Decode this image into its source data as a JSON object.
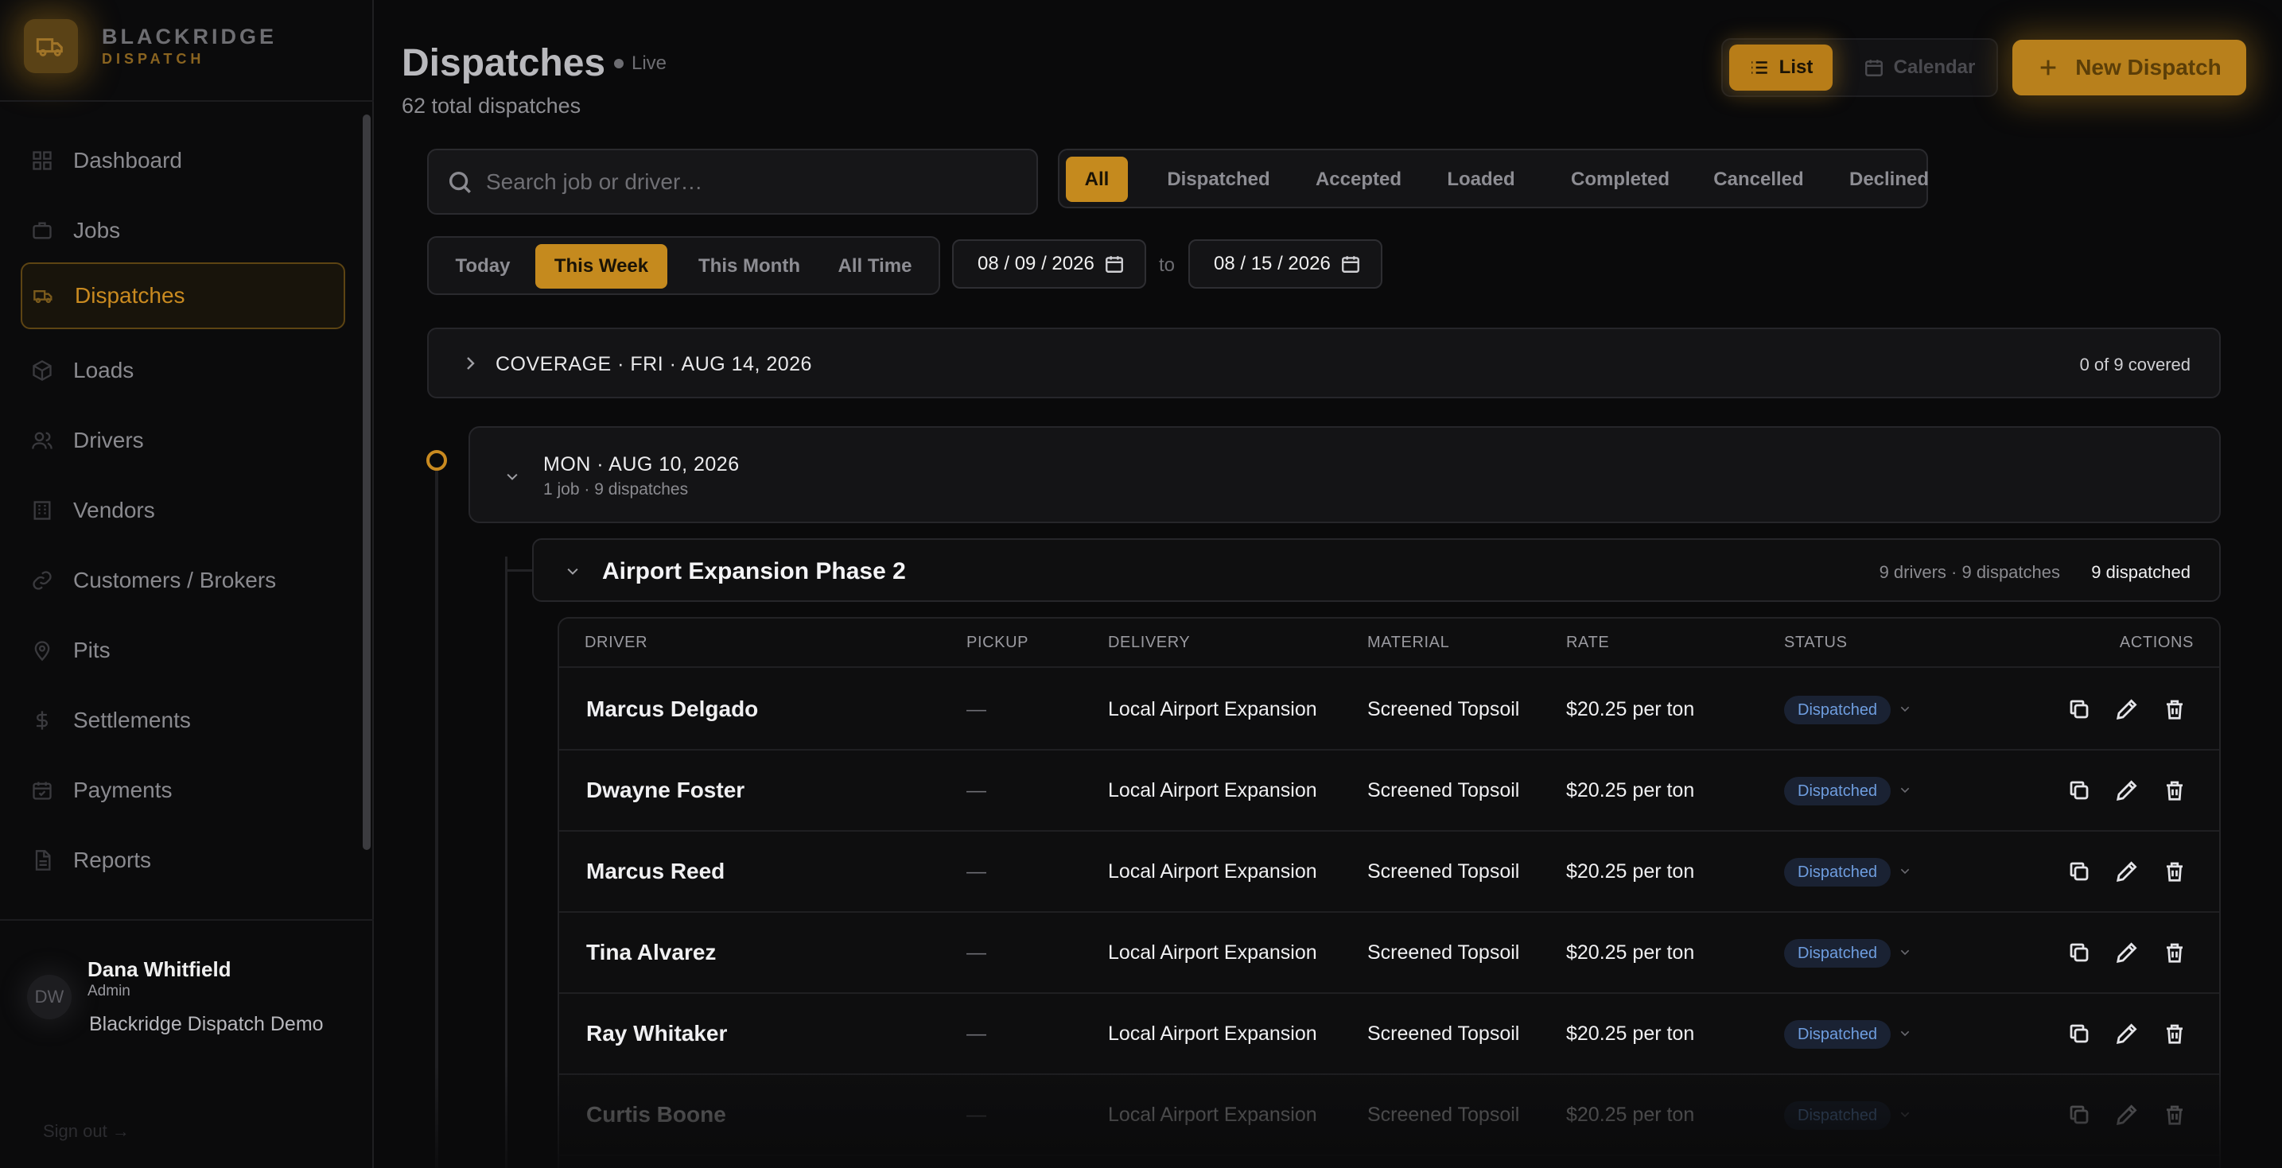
{
  "brand": {
    "name": "BLACKRIDGE",
    "sub": "DISPATCH",
    "logo_icon": "truck-icon"
  },
  "sidebar": {
    "items": [
      {
        "label": "Dashboard",
        "icon": "grid-icon"
      },
      {
        "label": "Jobs",
        "icon": "briefcase-icon"
      },
      {
        "label": "Dispatches",
        "icon": "truck-icon",
        "active": true
      },
      {
        "label": "Loads",
        "icon": "box-icon"
      },
      {
        "label": "Drivers",
        "icon": "users-icon"
      },
      {
        "label": "Vendors",
        "icon": "building-icon"
      },
      {
        "label": "Customers / Brokers",
        "icon": "link-icon"
      },
      {
        "label": "Pits",
        "icon": "map-pin-icon"
      },
      {
        "label": "Settlements",
        "icon": "dollar-icon"
      },
      {
        "label": "Payments",
        "icon": "calendar-check-icon"
      },
      {
        "label": "Reports",
        "icon": "file-icon"
      }
    ],
    "user": {
      "initials": "DW",
      "name": "Dana Whitfield",
      "role": "Admin",
      "org": "Blackridge Dispatch Demo"
    },
    "signout_label": "Sign out →"
  },
  "header": {
    "title": "Dispatches",
    "live_label": "Live",
    "subtitle": "62 total dispatches",
    "view_list": "List",
    "view_calendar": "Calendar",
    "new_button": "New Dispatch"
  },
  "filters": {
    "search_placeholder": "Search job or driver…",
    "status_tabs": [
      "All",
      "Dispatched",
      "Accepted",
      "Loaded",
      "Completed",
      "Cancelled",
      "Declined"
    ],
    "status_active": "All",
    "range_tabs": [
      "Today",
      "This Week",
      "This Month",
      "All Time"
    ],
    "range_active": "This Week",
    "date_from": "08 / 09 / 2026",
    "date_to": "08 / 15 / 2026",
    "to_label": "to"
  },
  "coverage": {
    "label": "COVERAGE · FRI · AUG 14, 2026",
    "count": "0 of 9 covered"
  },
  "day": {
    "title": "MON · AUG 10, 2026",
    "sub": "1 job · 9 dispatches"
  },
  "job": {
    "title": "Airport Expansion Phase 2",
    "meta": "9 drivers · 9 dispatches",
    "status": "9 dispatched"
  },
  "table": {
    "headers": [
      "DRIVER",
      "PICKUP",
      "DELIVERY",
      "MATERIAL",
      "RATE",
      "STATUS",
      "ACTIONS"
    ],
    "rows": [
      {
        "driver": "Marcus Delgado",
        "pickup": "—",
        "delivery": "Local Airport Expansion",
        "material": "Screened Topsoil",
        "rate": "$20.25 per ton",
        "status": "Dispatched"
      },
      {
        "driver": "Dwayne Foster",
        "pickup": "—",
        "delivery": "Local Airport Expansion",
        "material": "Screened Topsoil",
        "rate": "$20.25 per ton",
        "status": "Dispatched"
      },
      {
        "driver": "Marcus Reed",
        "pickup": "—",
        "delivery": "Local Airport Expansion",
        "material": "Screened Topsoil",
        "rate": "$20.25 per ton",
        "status": "Dispatched"
      },
      {
        "driver": "Tina Alvarez",
        "pickup": "—",
        "delivery": "Local Airport Expansion",
        "material": "Screened Topsoil",
        "rate": "$20.25 per ton",
        "status": "Dispatched"
      },
      {
        "driver": "Ray Whitaker",
        "pickup": "—",
        "delivery": "Local Airport Expansion",
        "material": "Screened Topsoil",
        "rate": "$20.25 per ton",
        "status": "Dispatched"
      },
      {
        "driver": "Curtis Boone",
        "pickup": "—",
        "delivery": "Local Airport Expansion",
        "material": "Screened Topsoil",
        "rate": "$20.25 per ton",
        "status": "Dispatched"
      }
    ]
  },
  "colors": {
    "accent": "#c58a1e",
    "status_dispatched": "#6f9ee0"
  }
}
